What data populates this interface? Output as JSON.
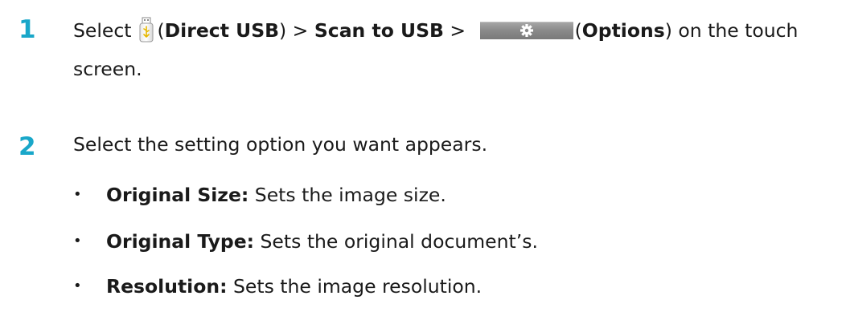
{
  "step1": {
    "number": "1",
    "select_word": "Select",
    "direct_usb_open": "(",
    "direct_usb_label": "Direct USB",
    "direct_usb_close": ")",
    "sep1": " > ",
    "scan_to_usb": "Scan to USB",
    "sep2": " > ",
    "options_open": "(",
    "options_label": "Options",
    "options_close": ")",
    "line1_end": " on the touch",
    "line2": "screen."
  },
  "step2": {
    "number": "2",
    "text": "Select the setting option you want appears.",
    "bullet_glyph": "•",
    "items": [
      {
        "term": "Original Size:",
        "desc": " Sets the image size."
      },
      {
        "term": "Original Type:",
        "desc": " Sets the original document’s."
      },
      {
        "term": "Resolution:",
        "desc": " Sets the image resolution."
      }
    ]
  },
  "colors": {
    "step_number": "#19a7c9",
    "text": "#1a1a1a"
  },
  "icons": {
    "direct_usb": "usb-drive-icon",
    "options": "gear-icon"
  }
}
